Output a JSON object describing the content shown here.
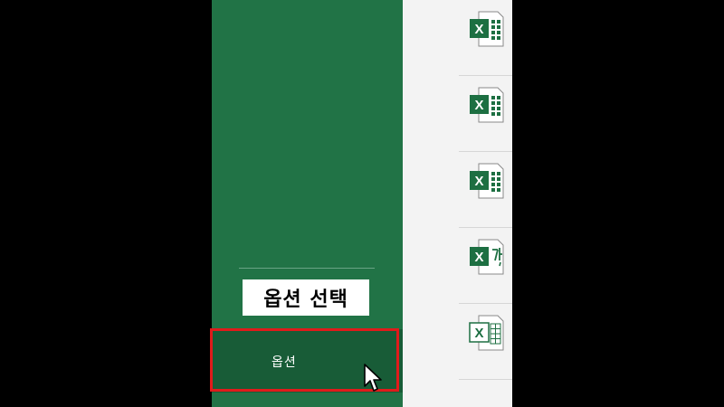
{
  "sidebar": {
    "options_label": "옵션"
  },
  "caption": {
    "text": "옵션 선택"
  },
  "files": [
    {
      "icon": "excel-workbook-icon",
      "badge": "X"
    },
    {
      "icon": "excel-workbook-icon",
      "badge": "X"
    },
    {
      "icon": "excel-workbook-icon",
      "badge": "X"
    },
    {
      "icon": "excel-template-icon",
      "badge": "X"
    },
    {
      "icon": "excel-sheet-icon",
      "badge": "X"
    }
  ],
  "colors": {
    "sidebar": "#217346",
    "selected": "#185c37",
    "highlight": "#e01b1b",
    "excel": "#1d6f42"
  }
}
